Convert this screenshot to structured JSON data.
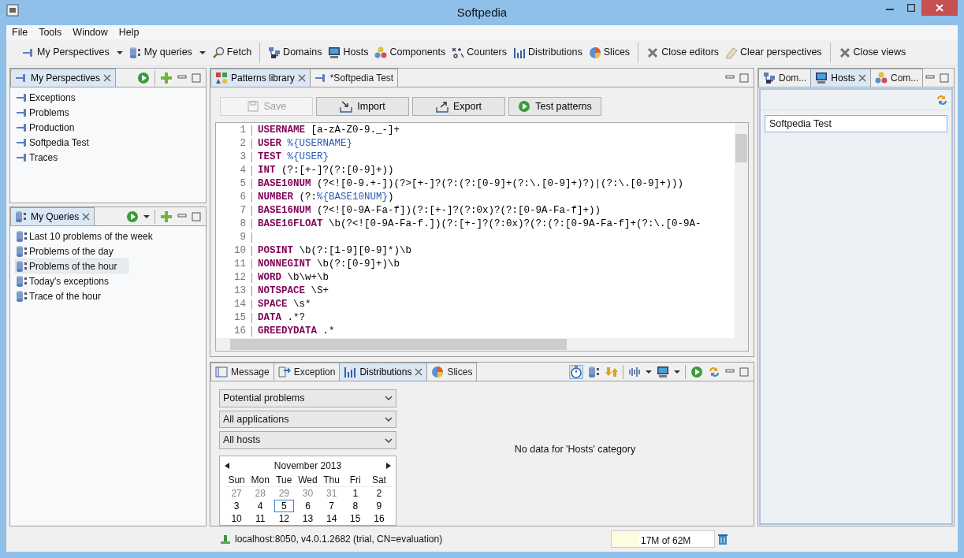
{
  "window": {
    "title": "Softpedia"
  },
  "menu": [
    "File",
    "Tools",
    "Window",
    "Help"
  ],
  "toolbar": [
    {
      "kind": "button",
      "label": "My Perspectives",
      "dropdown": true
    },
    {
      "kind": "button",
      "label": "My queries",
      "dropdown": true
    },
    {
      "kind": "button",
      "label": "Fetch",
      "dropdown": false
    },
    {
      "kind": "separator"
    },
    {
      "kind": "button",
      "label": "Domains",
      "dropdown": false
    },
    {
      "kind": "button",
      "label": "Hosts",
      "dropdown": false
    },
    {
      "kind": "button",
      "label": "Components",
      "dropdown": false
    },
    {
      "kind": "button",
      "label": "Counters",
      "dropdown": false
    },
    {
      "kind": "button",
      "label": "Distributions",
      "dropdown": false
    },
    {
      "kind": "button",
      "label": "Slices",
      "dropdown": false
    },
    {
      "kind": "separator"
    },
    {
      "kind": "button",
      "label": "Close editors",
      "dropdown": false
    },
    {
      "kind": "button",
      "label": "Clear perspectives",
      "dropdown": false
    },
    {
      "kind": "separator"
    },
    {
      "kind": "button",
      "label": "Close views",
      "dropdown": false
    }
  ],
  "perspectives": {
    "title": "My Perspectives",
    "items": [
      {
        "label": "Exceptions",
        "selected": false
      },
      {
        "label": "Problems",
        "selected": false
      },
      {
        "label": "Production",
        "selected": false
      },
      {
        "label": "Softpedia Test",
        "selected": false
      },
      {
        "label": "Traces",
        "selected": false
      }
    ]
  },
  "queries": {
    "title": "My Queries",
    "items": [
      {
        "label": "Last 10 problems of the week",
        "selected": false
      },
      {
        "label": "Problems of the day",
        "selected": false
      },
      {
        "label": "Problems of the hour",
        "selected": true
      },
      {
        "label": "Today's exceptions",
        "selected": false
      },
      {
        "label": "Trace of the hour",
        "selected": false
      }
    ]
  },
  "editor": {
    "tabs": [
      {
        "label": "Patterns library",
        "selected": true
      },
      {
        "label": "*Softpedia Test",
        "selected": false
      }
    ],
    "buttons": [
      {
        "label": "Save",
        "disabled": true
      },
      {
        "label": "Import",
        "disabled": false
      },
      {
        "label": "Export",
        "disabled": false
      },
      {
        "label": "Test patterns",
        "disabled": false
      }
    ],
    "lines": [
      {
        "number": "1",
        "name": "USERNAME",
        "pattern": "[a-zA-Z0-9._-]+"
      },
      {
        "number": "2",
        "name": "USER",
        "pattern": "%{USERNAME}"
      },
      {
        "number": "3",
        "name": "TEST",
        "pattern": "%{USER}"
      },
      {
        "number": "4",
        "name": "INT",
        "pattern": "(?:[+-]?(?:[0-9]+))"
      },
      {
        "number": "5",
        "name": "BASE10NUM",
        "pattern": "(?<![0-9.+-])(?>[+-]?(?:(?:[0-9]+(?:\\.[0-9]+)?)|(?:\\.[0-9]+)))"
      },
      {
        "number": "6",
        "name": "NUMBER",
        "pattern": "(?:%{BASE10NUM})"
      },
      {
        "number": "7",
        "name": "BASE16NUM",
        "pattern": "(?<![0-9A-Fa-f])(?:[+-]?(?:0x)?(?:[0-9A-Fa-f]+))"
      },
      {
        "number": "8",
        "name": "BASE16FLOAT",
        "pattern": "\\b(?<![0-9A-Fa-f.])(?:[+-]?(?:0x)?(?:(?:[0-9A-Fa-f]+(?:\\.[0-9A-"
      },
      {
        "number": "9"
      },
      {
        "number": "10",
        "name": "POSINT",
        "pattern": "\\b(?:[1-9][0-9]*)\\b"
      },
      {
        "number": "11",
        "name": "NONNEGINT",
        "pattern": "\\b(?:[0-9]+)\\b"
      },
      {
        "number": "12",
        "name": "WORD",
        "pattern": "\\b\\w+\\b"
      },
      {
        "number": "13",
        "name": "NOTSPACE",
        "pattern": "\\S+"
      },
      {
        "number": "14",
        "name": "SPACE",
        "pattern": "\\s*"
      },
      {
        "number": "15",
        "name": "DATA",
        "pattern": ".*?"
      },
      {
        "number": "16",
        "name": "GREEDYDATA",
        "pattern": ".*"
      }
    ]
  },
  "bottom": {
    "tabs": [
      {
        "label": "Message",
        "selected": false
      },
      {
        "label": "Exception",
        "selected": false
      },
      {
        "label": "Distributions",
        "selected": true
      },
      {
        "label": "Slices",
        "selected": false
      }
    ],
    "filters": [
      "Potential problems",
      "All applications",
      "All hosts"
    ],
    "calendar": {
      "month": "November 2013",
      "weekdays": [
        "Sun",
        "Mon",
        "Tue",
        "Wed",
        "Thu",
        "Fri",
        "Sat"
      ],
      "weeks": [
        [
          {
            "day": "27",
            "muted": true,
            "selected": false
          },
          {
            "day": "28",
            "muted": true,
            "selected": false
          },
          {
            "day": "29",
            "muted": true,
            "selected": false
          },
          {
            "day": "30",
            "muted": true,
            "selected": false
          },
          {
            "day": "31",
            "muted": true,
            "selected": false
          },
          {
            "day": "1",
            "muted": false,
            "selected": false
          },
          {
            "day": "2",
            "muted": false,
            "selected": false
          }
        ],
        [
          {
            "day": "3",
            "muted": false,
            "selected": false
          },
          {
            "day": "4",
            "muted": false,
            "selected": false
          },
          {
            "day": "5",
            "muted": false,
            "selected": true
          },
          {
            "day": "6",
            "muted": false,
            "selected": false
          },
          {
            "day": "7",
            "muted": false,
            "selected": false
          },
          {
            "day": "8",
            "muted": false,
            "selected": false
          },
          {
            "day": "9",
            "muted": false,
            "selected": false
          }
        ],
        [
          {
            "day": "10",
            "muted": false,
            "selected": false
          },
          {
            "day": "11",
            "muted": false,
            "selected": false
          },
          {
            "day": "12",
            "muted": false,
            "selected": false
          },
          {
            "day": "13",
            "muted": false,
            "selected": false
          },
          {
            "day": "14",
            "muted": false,
            "selected": false
          },
          {
            "day": "15",
            "muted": false,
            "selected": false
          },
          {
            "day": "16",
            "muted": false,
            "selected": false
          }
        ]
      ]
    },
    "message": "No data for 'Hosts' category"
  },
  "right": {
    "tabs": [
      {
        "label": "Dom...",
        "selected": false
      },
      {
        "label": "Hosts",
        "selected": true
      },
      {
        "label": "Com...",
        "selected": false
      }
    ],
    "field": {
      "value": "Softpedia Test"
    }
  },
  "status": {
    "server": "localhost:8050, v4.0.1.2682 (trial, CN=evaluation)",
    "memory": {
      "reading": "17M of 62M",
      "level": 0.27
    }
  }
}
